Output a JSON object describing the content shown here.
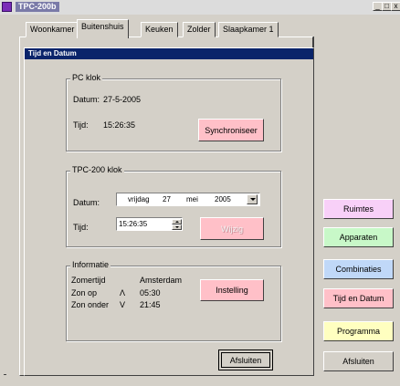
{
  "window": {
    "title": "TPC-200b",
    "min_label": "_",
    "max_label": "□",
    "close_label": "x"
  },
  "tabs": [
    "Woonkamer",
    "Buitenshuis",
    "Keuken",
    "Zolder",
    "Slaapkamer 1"
  ],
  "active_tab": "Buitenshuis",
  "dialog": {
    "title": "Tijd en Datum",
    "pc_clock": {
      "legend": "PC klok",
      "date_label": "Datum:",
      "date_value": "27-5-2005",
      "time_label": "Tijd:",
      "time_value": "15:26:35",
      "sync_button": "Synchroniseer"
    },
    "tpc_clock": {
      "legend": "TPC-200 klok",
      "date_label": "Datum:",
      "date_day": "vrijdag",
      "date_daynum": "27",
      "date_month": "mei",
      "date_year": "2005",
      "time_label": "Tijd:",
      "time_value": "15:26:35",
      "change_button": "Wijzig"
    },
    "info": {
      "legend": "Informatie",
      "dst_label": "Zomertijd",
      "location": "Amsterdam",
      "sunrise_label": "Zon op",
      "sunrise_symbol": "Λ",
      "sunrise_time": "05:30",
      "sunset_label": "Zon onder",
      "sunset_symbol": "V",
      "sunset_time": "21:45",
      "settings_button": "Instelling"
    },
    "close_button": "Afsluiten"
  },
  "sidebar": {
    "buttons": [
      {
        "label": "Ruimtes",
        "color": "#f8d0f8"
      },
      {
        "label": "Apparaten",
        "color": "#c8f8c8"
      },
      {
        "label": "Combinaties",
        "color": "#c0d8f8"
      },
      {
        "label": "Tijd en Datum",
        "color": "#ffc0c8"
      },
      {
        "label": "Programma",
        "color": "#ffffc0"
      },
      {
        "label": "Afsluiten",
        "color": "#d4d0c8"
      }
    ]
  }
}
